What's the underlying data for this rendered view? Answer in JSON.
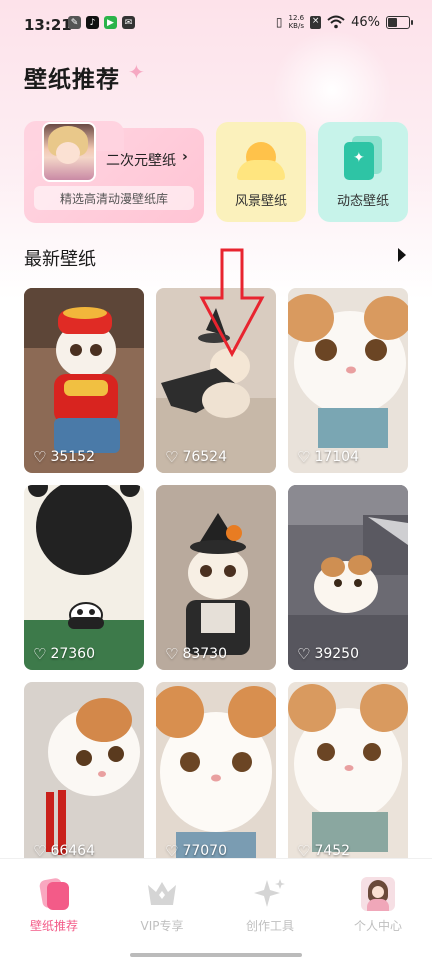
{
  "status_bar": {
    "time": "13:21",
    "net_speed_value": "12.6",
    "net_speed_unit": "KB/s",
    "battery": "46%",
    "battery_level": 0.46
  },
  "header": {
    "title": "壁纸推荐"
  },
  "categories": {
    "anime": {
      "label": "二次元壁纸",
      "arrow": "›",
      "subtitle": "精选高清动漫壁纸库"
    },
    "scenery": {
      "label": "风景壁纸"
    },
    "live": {
      "label": "动态壁纸"
    }
  },
  "section": {
    "title": "最新壁纸"
  },
  "wallpapers": [
    {
      "likes": "35152"
    },
    {
      "likes": "76524"
    },
    {
      "likes": "17104"
    },
    {
      "likes": "27360"
    },
    {
      "likes": "83730"
    },
    {
      "likes": "39250"
    },
    {
      "likes": "66464"
    },
    {
      "likes": "77070"
    },
    {
      "likes": "7452"
    }
  ],
  "bottom_nav": [
    {
      "label": "壁纸推荐",
      "active": true
    },
    {
      "label": "VIP专享",
      "active": false
    },
    {
      "label": "创作工具",
      "active": false
    },
    {
      "label": "个人中心",
      "active": false
    }
  ],
  "colors": {
    "accent": "#f35b88",
    "inactive_nav": "#bfbfbf",
    "annotation_arrow": "#e8242f"
  }
}
